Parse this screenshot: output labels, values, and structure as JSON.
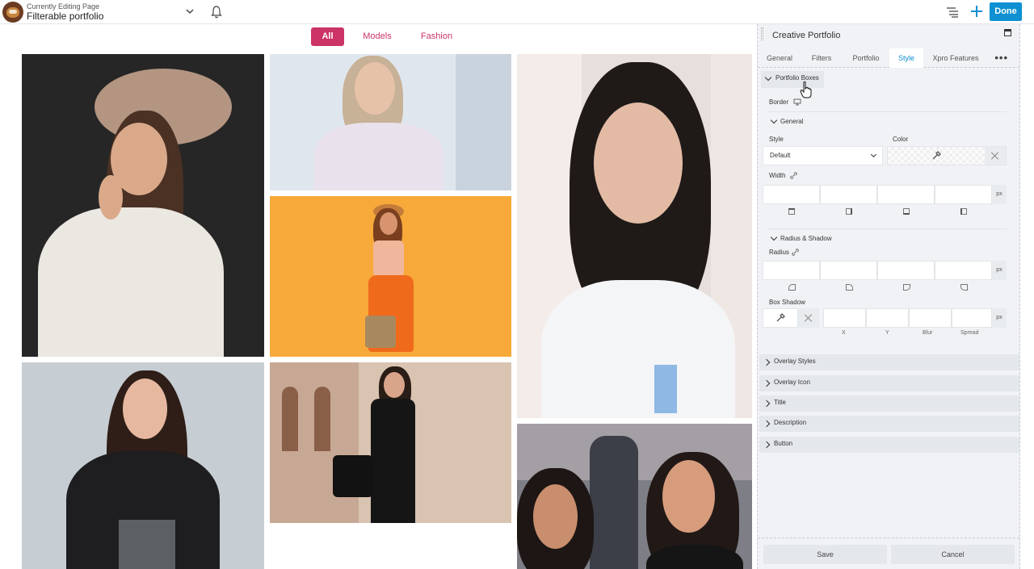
{
  "topbar": {
    "editing_small": "Currently Editing Page",
    "editing_title": "Filterable portfolio",
    "done_label": "Done"
  },
  "filters": [
    "All",
    "Models",
    "Fashion"
  ],
  "panel": {
    "title": "Creative Portfolio",
    "tabs": [
      "General",
      "Filters",
      "Portfolio",
      "Style",
      "Xpro Features"
    ],
    "active_tab": "Style",
    "more": "•••",
    "portfolio_boxes": {
      "header": "Portfolio Boxes",
      "border_label": "Border",
      "general_header": "General",
      "style_label": "Style",
      "style_value": "Default",
      "color_label": "Color",
      "width_label": "Width",
      "unit": "px",
      "radius_shadow_header": "Radius & Shadow",
      "radius_label": "Radius",
      "box_shadow_label": "Box Shadow",
      "shadow_axes": [
        "X",
        "Y",
        "Blur",
        "Spread"
      ]
    },
    "collapsed_sections": [
      "Overlay Styles",
      "Overlay Icon",
      "Title",
      "Description",
      "Button"
    ],
    "save_label": "Save",
    "cancel_label": "Cancel"
  },
  "colors": {
    "accent": "#cc3366",
    "primary": "#0e90d2",
    "panel_bg": "#f0f2f5"
  }
}
